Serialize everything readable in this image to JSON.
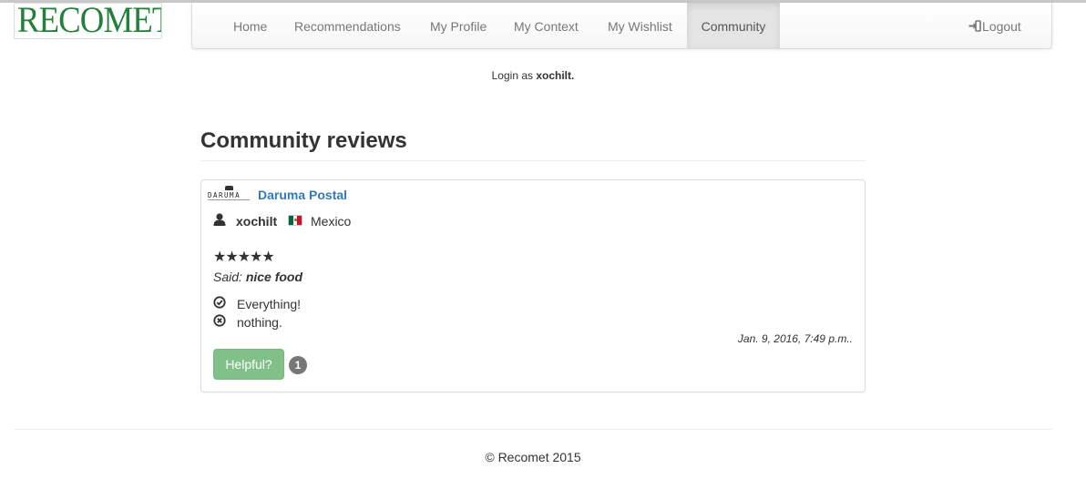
{
  "app": {
    "logo_text": "RECOMET"
  },
  "nav": {
    "items": [
      {
        "label": "Home"
      },
      {
        "label": "Recommendations"
      },
      {
        "label": "My Profile"
      },
      {
        "label": "My Context"
      },
      {
        "label": "My Wishlist"
      },
      {
        "label": "Community",
        "active": true
      }
    ],
    "logout_label": "Logout",
    "logout_icon": "log-in-icon"
  },
  "login": {
    "prefix": "Login as",
    "username": "xochilt."
  },
  "page": {
    "title": "Community reviews"
  },
  "review": {
    "restaurant_logo_text": "DARUMA",
    "restaurant_name": "Daruma Postal",
    "user_icon": "user-icon",
    "username": "xochilt",
    "country_flag": "mexico-flag",
    "country": "Mexico",
    "rating": 5,
    "stars": "★★★★★",
    "said_prefix": "Said:",
    "said_text": "nice food",
    "pro_icon": "check-circle-icon",
    "pro_text": "Everything!",
    "con_icon": "remove-circle-icon",
    "con_text": "nothing.",
    "date": "Jan. 9, 2016, 7:49 p.m..",
    "helpful_label": "Helpful?",
    "helpful_count": "1"
  },
  "footer": {
    "text": "© Recomet 2015"
  },
  "colors": {
    "logo_green": "#23803a",
    "link_blue": "#337ab7",
    "helpful_button": "#82c08a",
    "badge": "#777777",
    "flag_green": "#006847",
    "flag_red": "#ce1126"
  }
}
